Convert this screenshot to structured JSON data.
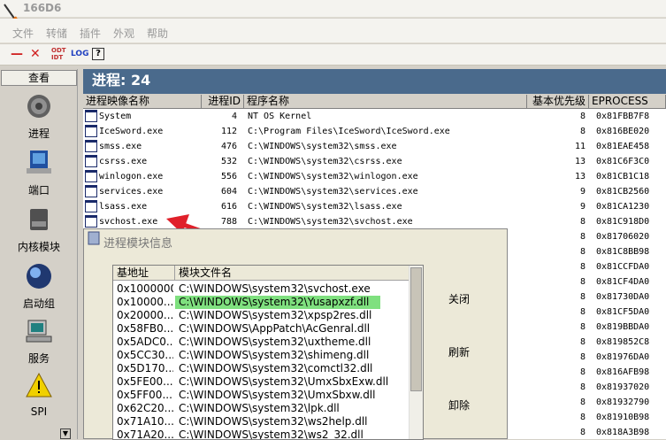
{
  "window": {
    "title": "166D6"
  },
  "menu": [
    "文件",
    "转储",
    "插件",
    "外观",
    "帮助"
  ],
  "toolbar": {
    "minus": "—",
    "close": "✕",
    "odt": "ODT IDT",
    "log": "LOG",
    "help": "?"
  },
  "sidebar": {
    "header": "查看",
    "items": [
      {
        "label": "进程",
        "icon": "gear-icon"
      },
      {
        "label": "端口",
        "icon": "network-icon"
      },
      {
        "label": "内核模块",
        "icon": "disk-icon"
      },
      {
        "label": "启动组",
        "icon": "globe-icon"
      },
      {
        "label": "服务",
        "icon": "computer-icon"
      },
      {
        "label": "SPI",
        "icon": "warning-icon"
      }
    ]
  },
  "process_header": "进程: 24",
  "columns": [
    "进程映像名称",
    "进程ID",
    "程序名称",
    "基本优先级",
    "EPROCESS"
  ],
  "rows": [
    {
      "name": "System",
      "pid": "4",
      "path": "NT OS Kernel",
      "pri": "8",
      "ep": "0x81FBB7F8"
    },
    {
      "name": "IceSword.exe",
      "pid": "112",
      "path": "C:\\Program Files\\IceSword\\IceSword.exe",
      "pri": "8",
      "ep": "0x816BE020"
    },
    {
      "name": "smss.exe",
      "pid": "476",
      "path": "C:\\WINDOWS\\system32\\smss.exe",
      "pri": "11",
      "ep": "0x81EAE458"
    },
    {
      "name": "csrss.exe",
      "pid": "532",
      "path": "C:\\WINDOWS\\system32\\csrss.exe",
      "pri": "13",
      "ep": "0x81C6F3C0"
    },
    {
      "name": "winlogon.exe",
      "pid": "556",
      "path": "C:\\WINDOWS\\system32\\winlogon.exe",
      "pri": "13",
      "ep": "0x81CB1C18"
    },
    {
      "name": "services.exe",
      "pid": "604",
      "path": "C:\\WINDOWS\\system32\\services.exe",
      "pri": "9",
      "ep": "0x81CB2560"
    },
    {
      "name": "lsass.exe",
      "pid": "616",
      "path": "C:\\WINDOWS\\system32\\lsass.exe",
      "pri": "9",
      "ep": "0x81CA1230"
    },
    {
      "name": "svchost.exe",
      "pid": "788",
      "path": "C:\\WINDOWS\\system32\\svchost.exe",
      "pri": "8",
      "ep": "0x81C918D0"
    },
    {
      "name": "",
      "pid": "",
      "path": "",
      "pri": "8",
      "ep": "0x81706020"
    },
    {
      "name": "",
      "pid": "",
      "path": "",
      "pri": "8",
      "ep": "0x81C8BB98"
    },
    {
      "name": "",
      "pid": "",
      "path": "",
      "pri": "8",
      "ep": "0x81CCFDA0"
    },
    {
      "name": "",
      "pid": "",
      "path": "",
      "pri": "8",
      "ep": "0x81CF4DA0"
    },
    {
      "name": "",
      "pid": "",
      "path": "",
      "pri": "8",
      "ep": "0x81730DA0"
    },
    {
      "name": "",
      "pid": "",
      "path": "",
      "pri": "8",
      "ep": "0x81CF5DA0"
    },
    {
      "name": "",
      "pid": "",
      "path": "",
      "pri": "8",
      "ep": "0x819BBDA0"
    },
    {
      "name": "",
      "pid": "",
      "path": "",
      "pri": "8",
      "ep": "0x819852C8"
    },
    {
      "name": "",
      "pid": "",
      "path": "",
      "pri": "8",
      "ep": "0x81976DA0"
    },
    {
      "name": "",
      "pid": "",
      "path": "",
      "pri": "8",
      "ep": "0x816AFB98"
    },
    {
      "name": "",
      "pid": "",
      "path": "",
      "pri": "8",
      "ep": "0x81937020"
    },
    {
      "name": "",
      "pid": "",
      "path": "",
      "pri": "8",
      "ep": "0x81932790"
    },
    {
      "name": "",
      "pid": "",
      "path": "",
      "pri": "8",
      "ep": "0x81910B98"
    },
    {
      "name": "",
      "pid": "",
      "path": "",
      "pri": "8",
      "ep": "0x818A3B98"
    }
  ],
  "dialog": {
    "title": "进程模块信息",
    "col_base": "基地址",
    "col_file": "模块文件名",
    "modules": [
      {
        "base": "0x1000000",
        "file": "C:\\WINDOWS\\system32\\svchost.exe"
      },
      {
        "base": "0x10000...",
        "file": "C:\\WINDOWS\\system32\\Yusapxzf.dll",
        "hl": true
      },
      {
        "base": "0x20000...",
        "file": "C:\\WINDOWS\\system32\\xpsp2res.dll"
      },
      {
        "base": "0x58FB0...",
        "file": "C:\\WINDOWS\\AppPatch\\AcGenral.dll"
      },
      {
        "base": "0x5ADC0...",
        "file": "C:\\WINDOWS\\system32\\uxtheme.dll"
      },
      {
        "base": "0x5CC30...",
        "file": "C:\\WINDOWS\\system32\\shimeng.dll"
      },
      {
        "base": "0x5D170...",
        "file": "C:\\WINDOWS\\system32\\comctl32.dll"
      },
      {
        "base": "0x5FE00...",
        "file": "C:\\WINDOWS\\system32\\UmxSbxExw.dll"
      },
      {
        "base": "0x5FF00...",
        "file": "C:\\WINDOWS\\system32\\UmxSbxw.dll"
      },
      {
        "base": "0x62C20...",
        "file": "C:\\WINDOWS\\system32\\lpk.dll"
      },
      {
        "base": "0x71A10...",
        "file": "C:\\WINDOWS\\system32\\ws2help.dll"
      },
      {
        "base": "0x71A20...",
        "file": "C:\\WINDOWS\\system32\\ws2_32.dll"
      }
    ],
    "btn_close": "关闭",
    "btn_refresh": "刷新",
    "btn_unload": "卸除"
  },
  "colors": {
    "header_bg": "#4a6a8c",
    "highlight": "#7fe07f",
    "arrow": "#e0202a"
  }
}
